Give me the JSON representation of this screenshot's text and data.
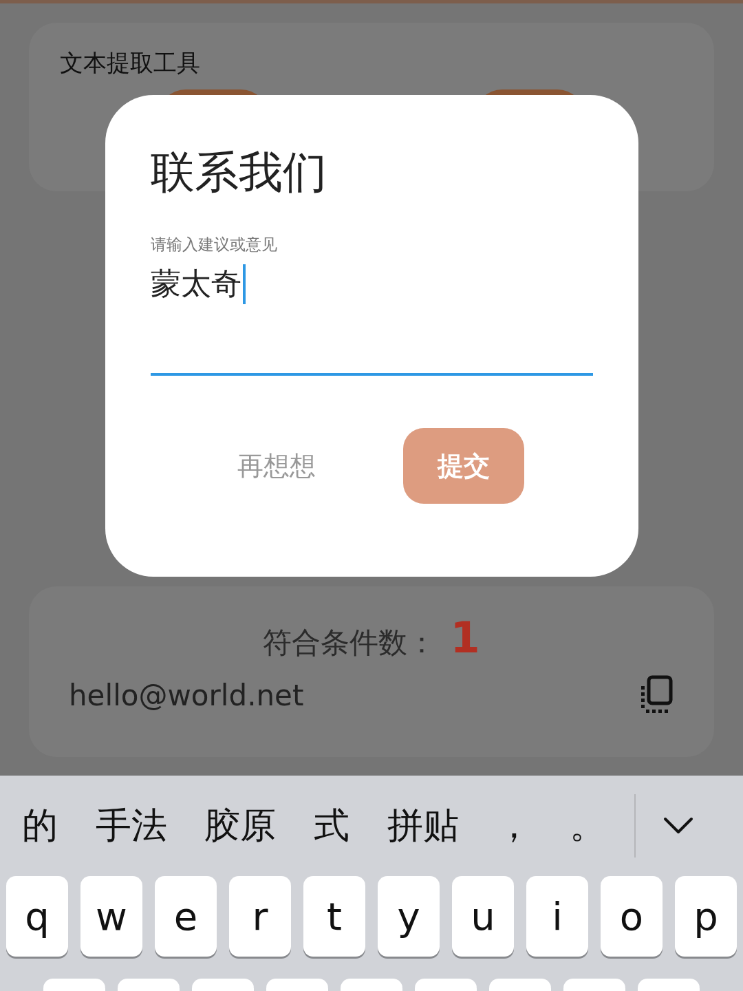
{
  "background": {
    "tool_title": "文本提取工具",
    "match_count_label": "符合条件数：",
    "match_count": "1",
    "result_email": "hello@world.net"
  },
  "dialog": {
    "title": "联系我们",
    "field": {
      "label": "请输入建议或意见",
      "value": "蒙太奇"
    },
    "buttons": [
      {
        "label": "再想想",
        "kind": "text"
      },
      {
        "label": "提交",
        "kind": "primary"
      }
    ]
  },
  "keyboard": {
    "candidates": [
      "的",
      "手法",
      "胶原",
      "式",
      "拼贴",
      "，",
      "。"
    ],
    "keys": [
      "q",
      "w",
      "e",
      "r",
      "t",
      "y",
      "u",
      "i",
      "o",
      "p"
    ]
  }
}
